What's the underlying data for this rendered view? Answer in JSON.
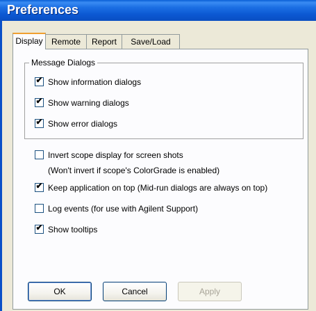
{
  "window": {
    "title": "Preferences"
  },
  "tabs": [
    {
      "label": "Display",
      "active": true
    },
    {
      "label": "Remote",
      "active": false
    },
    {
      "label": "Report",
      "active": false
    },
    {
      "label": "Save/Load",
      "active": false
    }
  ],
  "message_dialogs": {
    "title": "Message Dialogs",
    "items": [
      {
        "label": "Show information dialogs",
        "checked": true
      },
      {
        "label": "Show warning dialogs",
        "checked": true
      },
      {
        "label": "Show error dialogs",
        "checked": true
      }
    ]
  },
  "options": {
    "invert_scope": {
      "label": "Invert scope display for screen shots",
      "checked": false
    },
    "invert_note": "(Won't invert if scope's ColorGrade is enabled)",
    "keep_on_top": {
      "label": "Keep application on top (Mid-run dialogs are always on top)",
      "checked": true
    },
    "log_events": {
      "label": "Log events (for use with Agilent Support)",
      "checked": false
    },
    "show_tooltips": {
      "label": "Show tooltips",
      "checked": true
    }
  },
  "buttons": {
    "ok": "OK",
    "cancel": "Cancel",
    "apply": "Apply"
  },
  "check_glyph": "✔"
}
